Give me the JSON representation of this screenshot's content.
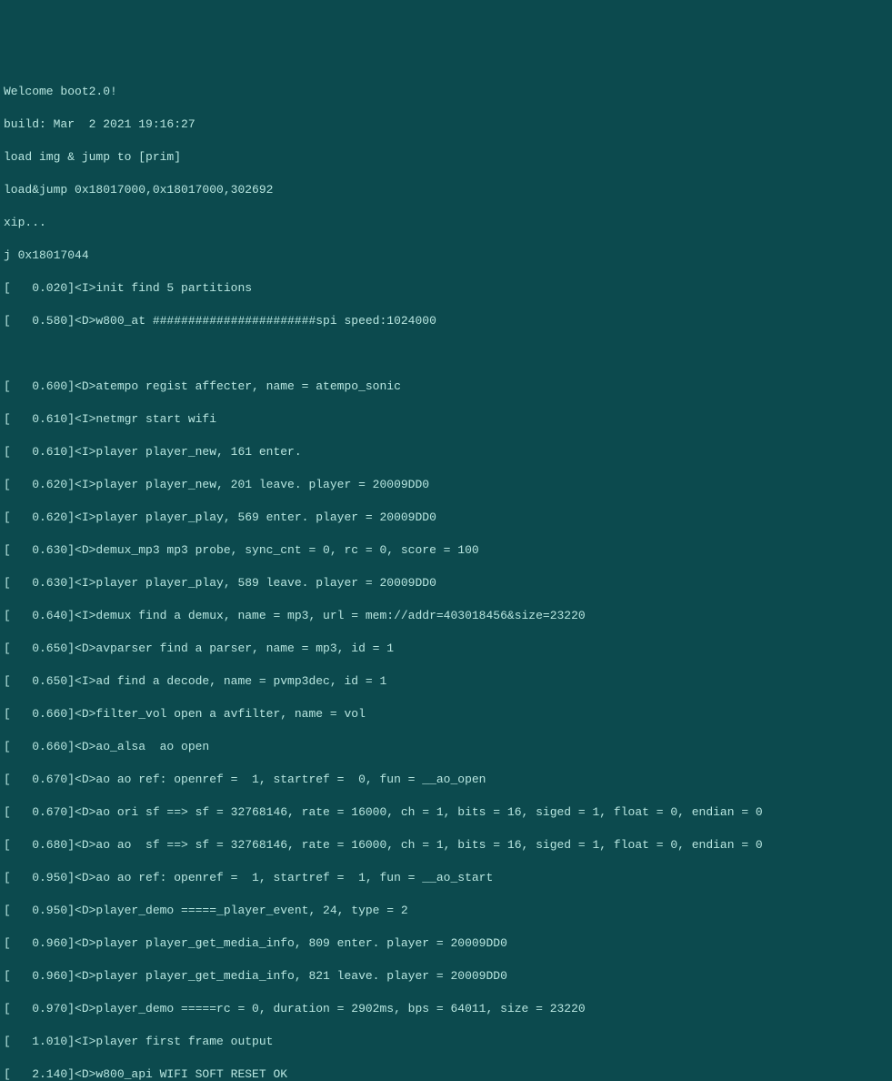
{
  "boot_header": {
    "welcome": "Welcome boot2.0!",
    "build": "build: Mar  2 2021 19:16:27",
    "load_img": "load img & jump to [prim]",
    "load_jump": "load&jump 0x18017000,0x18017000,302692",
    "xip": "xip...",
    "jump_addr": "j 0x18017044"
  },
  "log_lines": [
    "[   0.020]<I>init find 5 partitions",
    "[   0.580]<D>w800_at #######################spi speed:1024000",
    "",
    "[   0.600]<D>atempo regist affecter, name = atempo_sonic",
    "[   0.610]<I>netmgr start wifi",
    "[   0.610]<I>player player_new, 161 enter.",
    "[   0.620]<I>player player_new, 201 leave. player = 20009DD0",
    "[   0.620]<I>player player_play, 569 enter. player = 20009DD0",
    "[   0.630]<D>demux_mp3 mp3 probe, sync_cnt = 0, rc = 0, score = 100",
    "[   0.630]<I>player player_play, 589 leave. player = 20009DD0",
    "[   0.640]<I>demux find a demux, name = mp3, url = mem://addr=403018456&size=23220",
    "[   0.650]<D>avparser find a parser, name = mp3, id = 1",
    "[   0.650]<I>ad find a decode, name = pvmp3dec, id = 1",
    "[   0.660]<D>filter_vol open a avfilter, name = vol",
    "[   0.660]<D>ao_alsa  ao open",
    "[   0.670]<D>ao ao ref: openref =  1, startref =  0, fun = __ao_open",
    "[   0.670]<D>ao ori sf ==> sf = 32768146, rate = 16000, ch = 1, bits = 16, siged = 1, float = 0, endian = 0",
    "[   0.680]<D>ao ao  sf ==> sf = 32768146, rate = 16000, ch = 1, bits = 16, siged = 1, float = 0, endian = 0",
    "[   0.950]<D>ao ao ref: openref =  1, startref =  1, fun = __ao_start",
    "[   0.950]<D>player_demo =====_player_event, 24, type = 2",
    "[   0.960]<D>player player_get_media_info, 809 enter. player = 20009DD0",
    "[   0.960]<D>player player_get_media_info, 821 leave. player = 20009DD0",
    "[   0.970]<D>player_demo =====rc = 0, duration = 2902ms, bps = 64011, size = 23220",
    "[   1.010]<I>player first frame output",
    "[   2.140]<D>w800_api WIFI SOFT RESET OK"
  ]
}
